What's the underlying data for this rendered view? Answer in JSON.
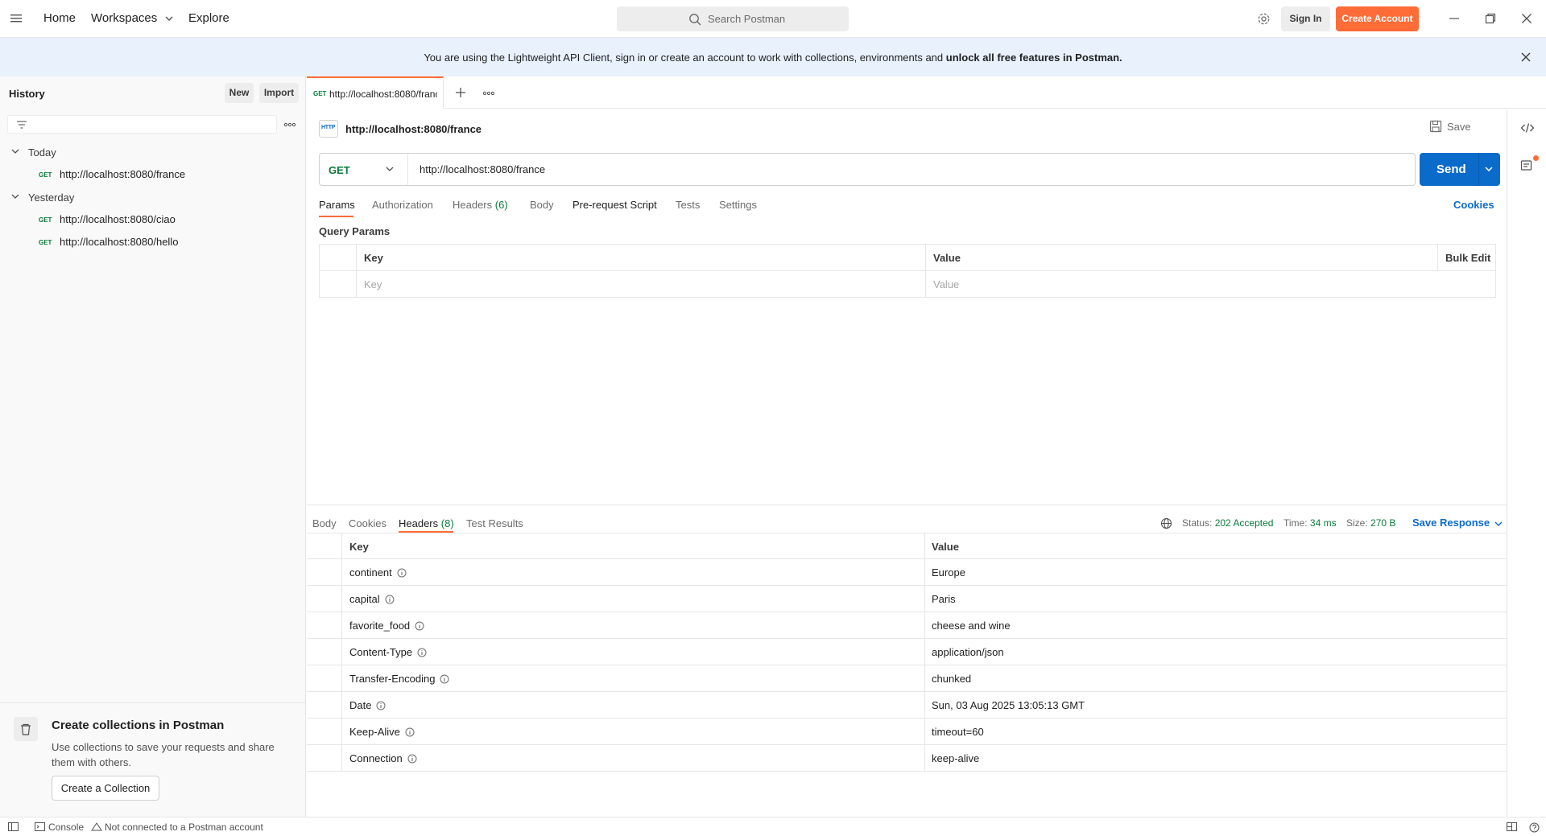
{
  "topbar": {
    "nav": [
      "Home",
      "Workspaces",
      "Explore"
    ],
    "search_placeholder": "Search Postman",
    "sign_in": "Sign In",
    "create_account": "Create Account"
  },
  "banner": {
    "text": "You are using the Lightweight API Client, sign in or create an account to work with collections, environments and ",
    "bold": "unlock all free features in Postman."
  },
  "sidebar": {
    "title": "History",
    "new_label": "New",
    "import_label": "Import",
    "groups": [
      {
        "label": "Today",
        "items": [
          {
            "method": "GET",
            "url": "http://localhost:8080/france"
          }
        ]
      },
      {
        "label": "Yesterday",
        "items": [
          {
            "method": "GET",
            "url": "http://localhost:8080/ciao"
          },
          {
            "method": "GET",
            "url": "http://localhost:8080/hello"
          }
        ]
      }
    ],
    "cta": {
      "title": "Create collections in Postman",
      "desc": "Use collections to save your requests and share them with others.",
      "button": "Create a Collection"
    }
  },
  "tab": {
    "method": "GET",
    "title": "http://localhost:8080/france"
  },
  "request": {
    "name": "http://localhost:8080/france",
    "http_badge": "HTTP",
    "save_label": "Save",
    "method": "GET",
    "url": "http://localhost:8080/france",
    "send_label": "Send",
    "tabs": [
      "Params",
      "Authorization",
      "Headers",
      "Body",
      "Pre-request Script",
      "Tests",
      "Settings"
    ],
    "headers_count": "(6)",
    "cookies_label": "Cookies",
    "query_params_title": "Query Params",
    "table_headers": {
      "key": "Key",
      "value": "Value",
      "bulk_edit": "Bulk Edit"
    },
    "key_placeholder": "Key",
    "value_placeholder": "Value"
  },
  "response": {
    "tabs": [
      "Body",
      "Cookies",
      "Headers",
      "Test Results"
    ],
    "headers_count": "(8)",
    "status_label": "Status:",
    "status_value": "202 Accepted",
    "time_label": "Time:",
    "time_value": "34 ms",
    "size_label": "Size:",
    "size_value": "270 B",
    "save_response": "Save Response",
    "table_headers": {
      "key": "Key",
      "value": "Value"
    },
    "headers": [
      {
        "key": "continent",
        "value": "Europe"
      },
      {
        "key": "capital",
        "value": "Paris"
      },
      {
        "key": "favorite_food",
        "value": "cheese and wine"
      },
      {
        "key": "Content-Type",
        "value": "application/json"
      },
      {
        "key": "Transfer-Encoding",
        "value": "chunked"
      },
      {
        "key": "Date",
        "value": "Sun, 03 Aug 2025 13:05:13 GMT"
      },
      {
        "key": "Keep-Alive",
        "value": "timeout=60"
      },
      {
        "key": "Connection",
        "value": "keep-alive"
      }
    ]
  },
  "statusbar": {
    "console": "Console",
    "account": "Not connected to a Postman account"
  },
  "colors": {
    "accent": "#ff6c37",
    "primary": "#0b6bcb",
    "get_method": "#0a7a3b",
    "banner_bg": "#e8f1fc"
  }
}
